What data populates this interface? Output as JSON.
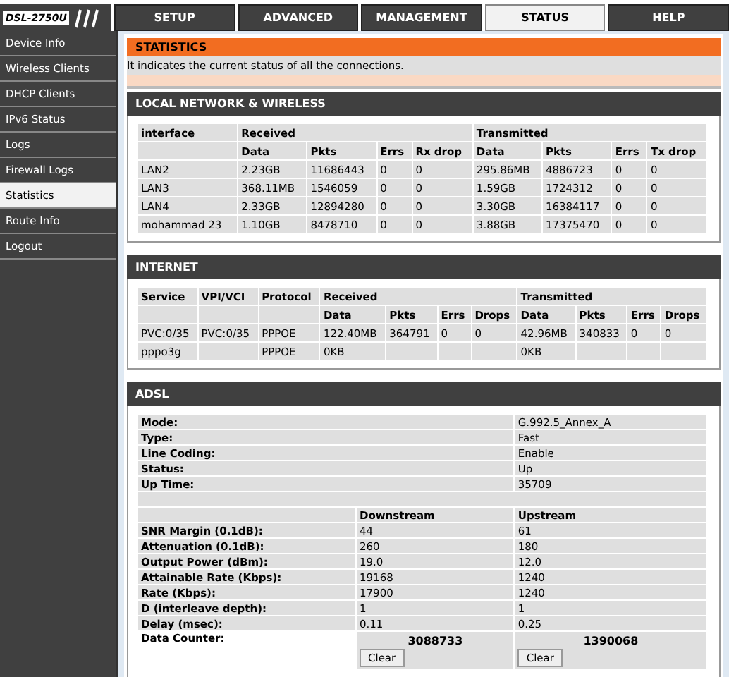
{
  "brand": "DSL-2750U",
  "tabs": [
    {
      "label": "SETUP",
      "selected": false
    },
    {
      "label": "ADVANCED",
      "selected": false
    },
    {
      "label": "MANAGEMENT",
      "selected": false
    },
    {
      "label": "STATUS",
      "selected": true
    },
    {
      "label": "HELP",
      "selected": false
    }
  ],
  "sidebar": {
    "items": [
      {
        "label": "Device Info",
        "selected": false
      },
      {
        "label": "Wireless Clients",
        "selected": false
      },
      {
        "label": "DHCP Clients",
        "selected": false
      },
      {
        "label": "IPv6 Status",
        "selected": false
      },
      {
        "label": "Logs",
        "selected": false
      },
      {
        "label": "Firewall Logs",
        "selected": false
      },
      {
        "label": "Statistics",
        "selected": true
      },
      {
        "label": "Route Info",
        "selected": false
      },
      {
        "label": "Logout",
        "selected": false
      }
    ]
  },
  "statistics": {
    "title": "STATISTICS",
    "description": "It indicates the current status of all the connections."
  },
  "local_network": {
    "title": "LOCAL NETWORK & WIRELESS",
    "first_column": "interface",
    "received": "Received",
    "transmitted": "Transmitted",
    "received_columns": [
      "Data",
      "Pkts",
      "Errs",
      "Rx drop"
    ],
    "transmitted_columns": [
      "Data",
      "Pkts",
      "Errs",
      "Tx drop"
    ],
    "rows": [
      [
        "LAN2",
        "2.23GB",
        "11686443",
        "0",
        "0",
        "295.86MB",
        "4886723",
        "0",
        "0"
      ],
      [
        "LAN3",
        "368.11MB",
        "1546059",
        "0",
        "0",
        "1.59GB",
        "1724312",
        "0",
        "0"
      ],
      [
        "LAN4",
        "2.33GB",
        "12894280",
        "0",
        "0",
        "3.30GB",
        "16384117",
        "0",
        "0"
      ],
      [
        "mohammad 23",
        "1.10GB",
        "8478710",
        "0",
        "0",
        "3.88GB",
        "17375470",
        "0",
        "0"
      ]
    ]
  },
  "internet": {
    "title": "INTERNET",
    "first_columns": [
      "Service",
      "VPI/VCI",
      "Protocol"
    ],
    "received": "Received",
    "transmitted": "Transmitted",
    "received_columns": [
      "Data",
      "Pkts",
      "Errs",
      "Drops"
    ],
    "transmitted_columns": [
      "Data",
      "Pkts",
      "Errs",
      "Drops"
    ],
    "rows": [
      [
        "PVC:0/35",
        "PVC:0/35",
        "PPPOE",
        "122.40MB",
        "364791",
        "0",
        "0",
        "42.96MB",
        "340833",
        "0",
        "0"
      ],
      [
        "pppo3g",
        "",
        "PPPOE",
        "0KB",
        "",
        "",
        "",
        "0KB",
        "",
        "",
        ""
      ]
    ]
  },
  "adsl": {
    "title": "ADSL",
    "info": [
      {
        "label": "Mode:",
        "value": "G.992.5_Annex_A"
      },
      {
        "label": "Type:",
        "value": "Fast"
      },
      {
        "label": "Line Coding:",
        "value": "Enable"
      },
      {
        "label": "Status:",
        "value": "Up"
      },
      {
        "label": "Up Time:",
        "value": "35709"
      }
    ],
    "downstream": "Downstream",
    "upstream": "Upstream",
    "rows": [
      {
        "label": "SNR Margin (0.1dB):",
        "downstream": "44",
        "upstream": "61"
      },
      {
        "label": "Attenuation (0.1dB):",
        "downstream": "260",
        "upstream": "180"
      },
      {
        "label": "Output Power (dBm):",
        "downstream": "19.0",
        "upstream": "12.0"
      },
      {
        "label": "Attainable Rate (Kbps):",
        "downstream": "19168",
        "upstream": "1240"
      },
      {
        "label": "Rate (Kbps):",
        "downstream": "17900",
        "upstream": "1240"
      },
      {
        "label": "D (interleave depth):",
        "downstream": "1",
        "upstream": "1"
      },
      {
        "label": "Delay (msec):",
        "downstream": "0.11",
        "upstream": "0.25"
      }
    ],
    "data_counter": {
      "label": "Data Counter:",
      "downstream": "3088733",
      "upstream": "1390068",
      "downstream_button": "Clear",
      "upstream_button": "Clear"
    }
  }
}
